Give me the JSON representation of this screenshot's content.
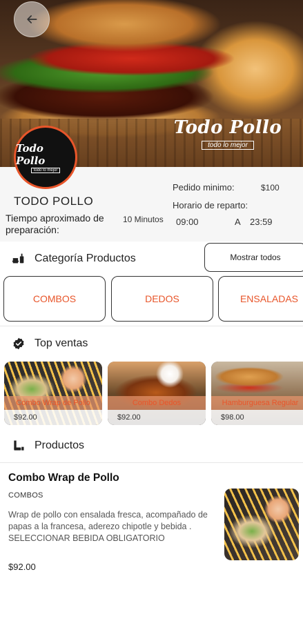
{
  "header": {
    "watermark_main": "Todo Pollo",
    "watermark_sub": "todo lo mejor",
    "logo_main": "Todo Pollo",
    "logo_sub": "todo lo mejor"
  },
  "store": {
    "name": "TODO POLLO",
    "prep_label": "Tiempo aproximado de preparación:",
    "prep_value": "10 Minutos",
    "min_order_label": "Pedido minimo:",
    "min_order_value": "$100",
    "hours_label": "Horario de reparto:",
    "hours_open": "09:00",
    "hours_sep": "A",
    "hours_close": "23:59"
  },
  "categories": {
    "title": "Categoría Productos",
    "show_all": "Mostrar todos",
    "items": [
      {
        "label": "COMBOS"
      },
      {
        "label": "DEDOS"
      },
      {
        "label": "ENSALADAS"
      }
    ]
  },
  "top_sales": {
    "title": "Top ventas",
    "items": [
      {
        "name": "Combo Wrap de Pollo",
        "price": "$92.00"
      },
      {
        "name": "Combo Dedos",
        "price": "$92.00"
      },
      {
        "name": "Hamburguesa Regular",
        "price": "$98.00"
      }
    ]
  },
  "products": {
    "title": "Productos",
    "items": [
      {
        "name": "Combo Wrap de Pollo",
        "category": "COMBOS",
        "description": "Wrap de pollo con ensalada fresca, acompañado de papas a la francesa, aderezo chipotle y bebida . SELECCIONAR BEBIDA OBLIGATORIO",
        "price": "$92.00"
      }
    ]
  },
  "colors": {
    "accent": "#e8552a",
    "text": "#222222",
    "panel": "#f6f6f6"
  }
}
